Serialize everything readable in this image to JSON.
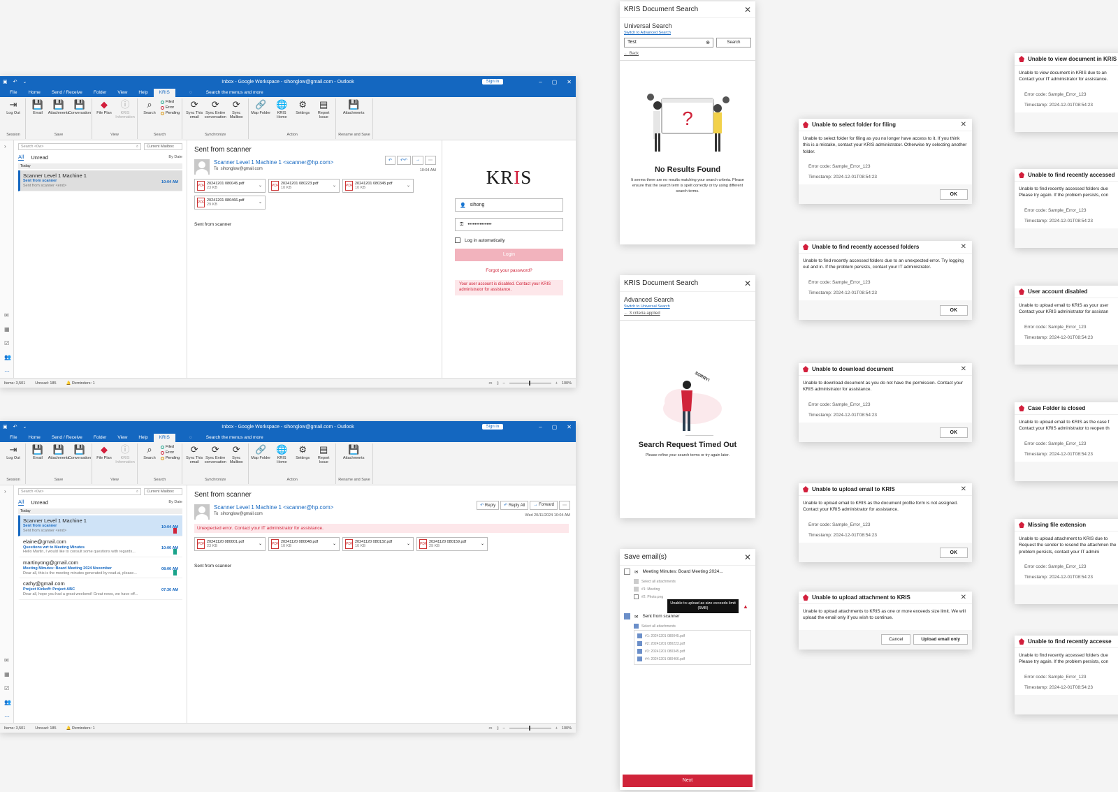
{
  "outlook": {
    "title": "Inbox - Google Workspace - sihonglow@gmail.com - Outlook",
    "sign_in": "Sign in",
    "menu": [
      "File",
      "Home",
      "Send / Receive",
      "Folder",
      "View",
      "Help",
      "KRIS"
    ],
    "search_menus": "Search the menus and more",
    "ribbon": {
      "log_out": "Log Out",
      "session": "Session",
      "email": "Email",
      "attachments": "Attachments",
      "conversation": "Conversation",
      "save": "Save",
      "file_plan": "File Plan",
      "kris_info": "KRIS Information",
      "view": "View",
      "search": "Search",
      "filed": "Filed",
      "error": "Error",
      "pending": "Pending",
      "search_grp": "Search",
      "sync_email": "Sync This email",
      "sync_conv": "Sync Entire conversation",
      "sync_mailbox": "Sync Mailbox",
      "synchronize": "Synchronize",
      "map_folder": "Map Folder",
      "kris_home": "KRIS Home",
      "settings": "Settings",
      "report_issue": "Report Issue",
      "action": "Action",
      "attach": "Attachments",
      "rename": "Rename and Save"
    },
    "search_placeholder": "Search <0w>",
    "current_mailbox": "Current Mailbox",
    "all": "All",
    "unread": "Unread",
    "by_date": "By Date",
    "today": "Today",
    "status": {
      "items": "Items: 3,501",
      "unread": "Unread: 185",
      "reminders": "Reminders: 1",
      "zoom": "100%"
    }
  },
  "window1": {
    "mail": {
      "from": "Scanner Level 1 Machine 1",
      "subject": "Sent from scanner",
      "preview": "Sent from scanner <end>",
      "time": "10:04 AM"
    },
    "subject": "Sent from scanner",
    "sender": "Scanner Level 1 Machine 1 <scanner@hp.com>",
    "to": "sihonglow@gmail.com",
    "time": "10:04 AM",
    "attachments": [
      {
        "name": "20241201 080045.pdf",
        "size": "23 KB"
      },
      {
        "name": "20241201 080223.pdf",
        "size": "10 KB"
      },
      {
        "name": "20241201 080345.pdf",
        "size": "10 KB"
      },
      {
        "name": "20241201 080466.pdf",
        "size": "29 KB"
      }
    ],
    "body": "Sent from scanner",
    "login": {
      "logo_a": "KR",
      "logo_b": "I",
      "logo_c": "S",
      "username": "sihong",
      "password": "••••••••••••••",
      "auto": "Log in automatically",
      "button": "Login",
      "forgot": "Forgot your password?",
      "error": "Your user account is disabled. Contact your KRIS administrator for assistance."
    }
  },
  "window2": {
    "mails": [
      {
        "from": "Scanner Level 1 Machine 1",
        "subject": "Sent from scanner",
        "preview": "Sent from scanner <end>",
        "time": "10:04 AM",
        "tag": "#d0243a"
      },
      {
        "from": "elaine@gmail.com",
        "subject": "Questions wrt to Meeting Minutes",
        "preview": "Hello Martin, I would like to consult some questions with regards...",
        "time": "10:00 AM",
        "tag": "#1aa38a"
      },
      {
        "from": "martinyong@gmail.com",
        "subject": "Meeting Minutes: Board Meeting 2024 November",
        "preview": "Dear all, this is the meeting minutes generated by read.ai, please...",
        "time": "08:00 AM",
        "tag": "#1aa38a"
      },
      {
        "from": "cathy@gmail.com",
        "subject": "Project Kickoff: Project ABC",
        "preview": "Dear all, hope you had a great weekend! Great news, we have off...",
        "time": "07:30 AM",
        "tag": ""
      }
    ],
    "subject": "Sent from scanner",
    "sender": "Scanner Level 1 Machine 1 <scanner@hp.com>",
    "to": "sihonglow@gmail.com",
    "reply": "Reply",
    "reply_all": "Reply All",
    "forward": "Forward",
    "date": "Wed 20/11/2024 10:04 AM",
    "error": "Unexpected error. Contact your IT administrator for assistance.",
    "attachments": [
      {
        "name": "20241120 080001.pdf",
        "size": "23 KB"
      },
      {
        "name": "20241120 080048.pdf",
        "size": "10 KB"
      },
      {
        "name": "20241120 080132.pdf",
        "size": "10 KB"
      },
      {
        "name": "20241120 080159.pdf",
        "size": "29 KB"
      }
    ],
    "body": "Sent from scanner"
  },
  "universal": {
    "title": "KRIS Document Search",
    "mode": "Universal Search",
    "switch": "Switch to Advanced Search",
    "query": "Test",
    "search": "Search",
    "back": "Back",
    "heading": "No Results Found",
    "text": "It seems there are no results matching your search criteria. Please ensure that the search term is spelt correctly or try using different search terms."
  },
  "advanced": {
    "title": "KRIS Document Search",
    "mode": "Advanced Search",
    "switch": "Switch to Universal Search",
    "criteria": "3 criteria applied",
    "sorry": "SORRY!",
    "heading": "Search Request Timed Out",
    "text": "Please refine your search terms or try again later."
  },
  "save_emails": {
    "title": "Save email(s)",
    "email1": "Meeting Minutes: Board Meeting 2024...",
    "select_all": "Select all attachments",
    "e1_att1": "#1: Meeting",
    "e1_att2": "#2: Photo.png",
    "tooltip": "Unable to upload as size exceeds limit (5MB)",
    "email2": "Sent from scanner",
    "e2_atts": [
      "#1: 20241201 080045.pdf",
      "#2: 20241201 080223.pdf",
      "#3: 20241201 080345.pdf",
      "#4: 20241201 080466.pdf"
    ],
    "next": "Next"
  },
  "dialogs_mid": [
    {
      "title": "Unable to select folder for filing",
      "body": "Unable to select folder for filing as you no longer have access to it. If you think this is a mistake, contact your KRIS administrator. Otherwise try selecting another folder.",
      "code": "Error code: Sample_Error_123",
      "ts": "Timestamp: 2024-12-01T08:54:23",
      "ok": "OK"
    },
    {
      "title": "Unable to find recently accessed folders",
      "body": "Unable to find recently accessed folders due to an unexpected error. Try logging out and in. If the problem persists, contact your IT administrator.",
      "code": "Error code: Sample_Error_123",
      "ts": "Timestamp: 2024-12-01T08:54:23",
      "ok": "OK"
    },
    {
      "title": "Unable to download document",
      "body": "Unable to download document as you do not have the permission. Contact your KRIS administrator for assistance.",
      "code": "Error code: Sample_Error_123",
      "ts": "Timestamp: 2024-12-01T08:54:23",
      "ok": "OK"
    },
    {
      "title": "Unable to upload email to KRIS",
      "body": "Unable to upload email to KRIS as the document profile form is not assigned. Contact your KRIS administrator for assistance.",
      "code": "Error code: Sample_Error_123",
      "ts": "Timestamp: 2024-12-01T08:54:23",
      "ok": "OK"
    }
  ],
  "dialog_upload": {
    "title": "Unable to upload attachment to KRIS",
    "body": "Unable to upload attachments to KRIS as one or more exceeds size limit. We will upload the email only if you wish to continue.",
    "cancel": "Cancel",
    "upload": "Upload email only"
  },
  "dialogs_right": [
    {
      "title": "Unable to view document in KRIS",
      "body": "Unable to view document in KRIS due to an Contact your IT administrator for assistance.",
      "code": "Error code: Sample_Error_123",
      "ts": "Timestamp: 2024-12-01T08:54:23"
    },
    {
      "title": "Unable to find recently accessed",
      "body": "Unable to find recently accessed folders due Please try again. If the problem persists, con",
      "code": "Error code: Sample_Error_123",
      "ts": "Timestamp: 2024-12-01T08:54:23"
    },
    {
      "title": "User account disabled",
      "body": "Unable to upload email to KRIS as your user Contact your KRIS administrator for assistan",
      "code": "Error code: Sample_Error_123",
      "ts": "Timestamp: 2024-12-01T08:54:23"
    },
    {
      "title": "Case Folder is closed",
      "body": "Unable to upload email to KRIS as the case f Contact your KRIS administrator to reopen th",
      "code": "Error code: Sample_Error_123",
      "ts": "Timestamp: 2024-12-01T08:54:23"
    },
    {
      "title": "Missing file extension",
      "body": "Unable to upload attachment to KRIS due to Request the sender to resend the attachmen the problem persists, contact your IT admini",
      "code": "Error code: Sample_Error_123",
      "ts": "Timestamp: 2024-12-01T08:54:23"
    },
    {
      "title": "Unable to find recently accesse",
      "body": "Unable to find recently accessed folders due Please try again. If the problem persists, con",
      "code": "Error code: Sample_Error_123",
      "ts": "Timestamp: 2024-12-01T08:54:23"
    }
  ]
}
